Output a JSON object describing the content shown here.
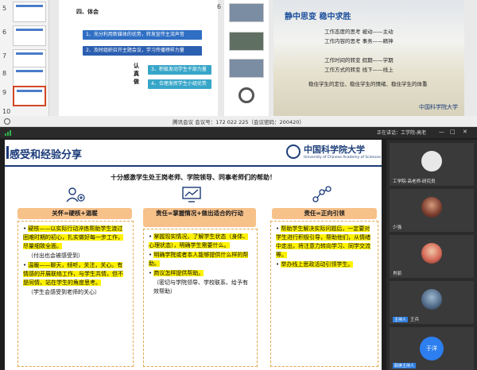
{
  "ppt": {
    "slide_numbers": [
      "5",
      "6",
      "7",
      "8",
      "9",
      "10"
    ],
    "slide1": {
      "section_title": "四、体会",
      "items": [
        "1、充分利用新媒体的优势，转发宣传主流声音",
        "2、及时组织召开主题会议，学习传播榜样力量",
        "3、积极发动学生干部力量",
        "4、合理发挥学生小组优势"
      ],
      "side_label_1": "认",
      "side_label_2": "真",
      "side_label_3": "做"
    },
    "slide3": {
      "title": "静中思变  稳中求胜",
      "lines": [
        "工作态度的思考      被动——主动",
        "工作内容的思考      事务——精神",
        "工作时间的转变      假期——学期",
        "工作方式的转变      线下——线上",
        "稳住学生的定位、稳住学生的情绪、稳住学生的体重"
      ],
      "logo_text": "中国科学院大学"
    },
    "edge_number": "6"
  },
  "meeting": {
    "window_title": "腾讯会议  会议号：172 022 225（会议密码：200420）",
    "speaking_label": "正在讲话：工学院-高老",
    "window_buttons": [
      "—",
      "□",
      "✕"
    ]
  },
  "shared_slide": {
    "title": "感受和经验分享",
    "logo_cn": "中国科学院大学",
    "logo_en": "University of Chinese Academy of Sciences",
    "thanks": "十分感激学生处王岗老师、学院领导、同事老师们的帮助！",
    "columns": [
      {
        "header": "关怀=硬核+温暖",
        "bullets": [
          {
            "text": "硬核——以实际行动淬炼帮助学生渡过困难时期的初心，扎实做好每一步工作，尽量细致全面。",
            "highlight": true
          },
          {
            "text": "（付出也会被感受到）",
            "highlight": false,
            "plain": true
          },
          {
            "text": "温暖——聊天，倾听，关注，关心。有情感的开展联络工作，与学生共情，但不是同情，站在学生的角度思考。",
            "highlight": true
          },
          {
            "text": "（学生会感受到老师的关心）",
            "highlight": false,
            "plain": true
          }
        ]
      },
      {
        "header": "责任=掌握情况+做出适合的行动",
        "bullets": [
          {
            "text": "掌握现实情况，了解学生状态（身体、心理状态），明确学生需要什么。",
            "highlight": true
          },
          {
            "text": "明确学院或者本人能够提供什么样的帮助。",
            "highlight": true
          },
          {
            "text": "商议怎样提供帮助。",
            "highlight": true
          },
          {
            "text": "（密切与学院领导、学校联系、给予有效帮助）",
            "highlight": false,
            "plain": true
          }
        ]
      },
      {
        "header": "责任=正向引领",
        "bullets": [
          {
            "text": "帮助学生解决实际问题后，一定要对学生进行积极引导，帮助他们，从情绪中走出，将注意力转向学习、同学交流等。",
            "highlight": true
          },
          {
            "text": "举办线上思政活动引领学生。",
            "highlight": true
          }
        ]
      }
    ]
  },
  "participants": [
    {
      "name": "工学院-高老师-研究员",
      "avatar": "white"
    },
    {
      "name": "少强",
      "avatar": "photo1"
    },
    {
      "name": "肖丽",
      "avatar": "photo2"
    },
    {
      "name": "王兵",
      "avatar": "photo3",
      "tag": "主持人"
    },
    {
      "name": "于洋",
      "avatar": "blue",
      "tag": "联席主持人"
    }
  ],
  "colors": {
    "accent_navy": "#1a3a78",
    "header_orange": "#f7c18a",
    "dash_orange": "#e3a64a",
    "highlight_yellow": "#fff200",
    "meeting_blue": "#2d7ff0"
  }
}
